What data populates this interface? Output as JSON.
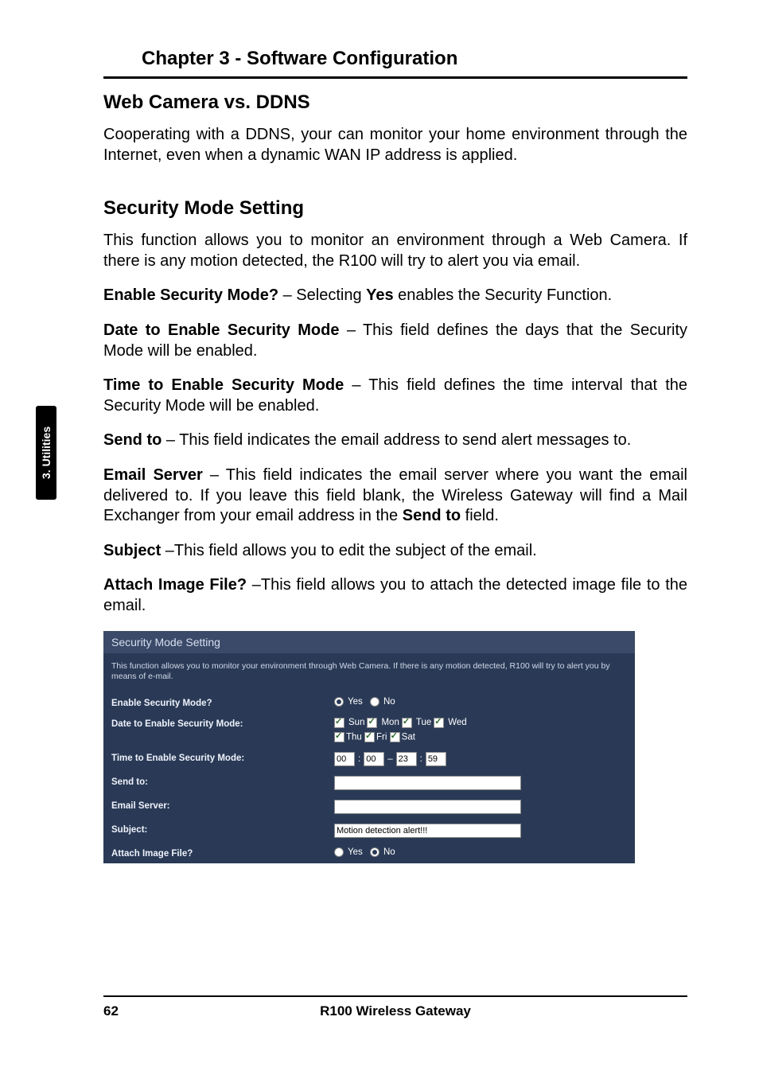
{
  "chapter": "Chapter 3 - Software Configuration",
  "side_tab": "3. Utilities",
  "s1": {
    "title": "Web Camera vs. DDNS",
    "p1": "Cooperating with a DDNS, your can monitor your home environment through the Internet, even when a dynamic WAN IP address is applied."
  },
  "s2": {
    "title": "Security Mode Setting",
    "p1": "This function allows you to monitor an environment through a Web Camera. If there is any motion detected, the R100 will try to alert you via email.",
    "p2a": "Enable Security Mode?",
    "p2b": " – Selecting ",
    "p2c": "Yes",
    "p2d": " enables the Security Function.",
    "p3a": "Date to Enable Security Mode",
    "p3b": " – This field defines the days that the Security Mode will be enabled.",
    "p4a": "Time to Enable Security Mode",
    "p4b": " – This field defines the time interval that the Security Mode will be enabled.",
    "p5a": "Send to",
    "p5b": " – This field indicates the email address to send alert messages to.",
    "p6a": "Email Server",
    "p6b": " – This field indicates the email server where you want the email delivered to. If you leave this field blank, the Wireless Gateway will find a Mail Exchanger from your email address in the ",
    "p6c": "Send to",
    "p6d": " field.",
    "p7a": "Subject",
    "p7b": " –This field allows you to edit the subject of the email.",
    "p8a": "Attach Image File?",
    "p8b": " –This field allows you to attach  the detected image file to the email."
  },
  "panel": {
    "title": "Security Mode Setting",
    "desc": "This function allows you to monitor your environment through Web Camera. If there is any motion detected, R100 will try to alert you by means of e-mail.",
    "rows": {
      "enable": "Enable Security Mode?",
      "date": "Date to Enable Security Mode:",
      "time": "Time to Enable Security Mode:",
      "sendto": "Send to:",
      "emailserver": "Email Server:",
      "subject": "Subject:",
      "attach": "Attach Image File?"
    },
    "opt": {
      "yes": "Yes",
      "no": "No"
    },
    "days": {
      "sun": "Sun",
      "mon": "Mon",
      "tue": "Tue",
      "wed": "Wed",
      "thu": "Thu",
      "fri": "Fri",
      "sat": "Sat"
    },
    "time": {
      "h1": "00",
      "m1": "00",
      "h2": "23",
      "m2": "59"
    },
    "subject_val": "Motion detection alert!!!",
    "sendto_val": "",
    "emailserver_val": ""
  },
  "footer": {
    "page": "62",
    "title": "R100 Wireless Gateway"
  }
}
